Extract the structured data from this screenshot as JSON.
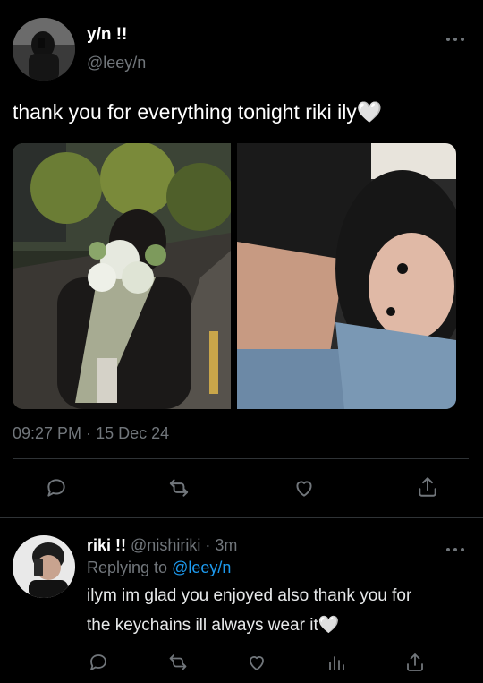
{
  "tweet": {
    "display_name": "y/n !!",
    "handle": "@leey/n",
    "text": "thank you for everything tonight riki ily🤍",
    "time": "09:27 PM",
    "separator": "·",
    "date": "15 Dec 24",
    "photos": [
      "bouquet-photo",
      "couple-selfie-photo"
    ]
  },
  "reply": {
    "display_name": "riki !!",
    "handle": "@nishiriki",
    "separator": "·",
    "age": "3m",
    "replying_prefix": "Replying to",
    "replying_handle": "@leey/n",
    "line1": "ilym im glad you enjoyed also thank you for",
    "line2": "the keychains ill always wear it🤍"
  },
  "icons": {
    "reply": "reply-icon",
    "retweet": "retweet-icon",
    "like": "like-icon",
    "share": "share-icon",
    "views": "views-icon",
    "more": "more-icon"
  },
  "colors": {
    "background": "#000000",
    "text": "#e7e9ea",
    "muted": "#71767b",
    "link": "#1d9bf0",
    "divider": "#2f3336"
  }
}
